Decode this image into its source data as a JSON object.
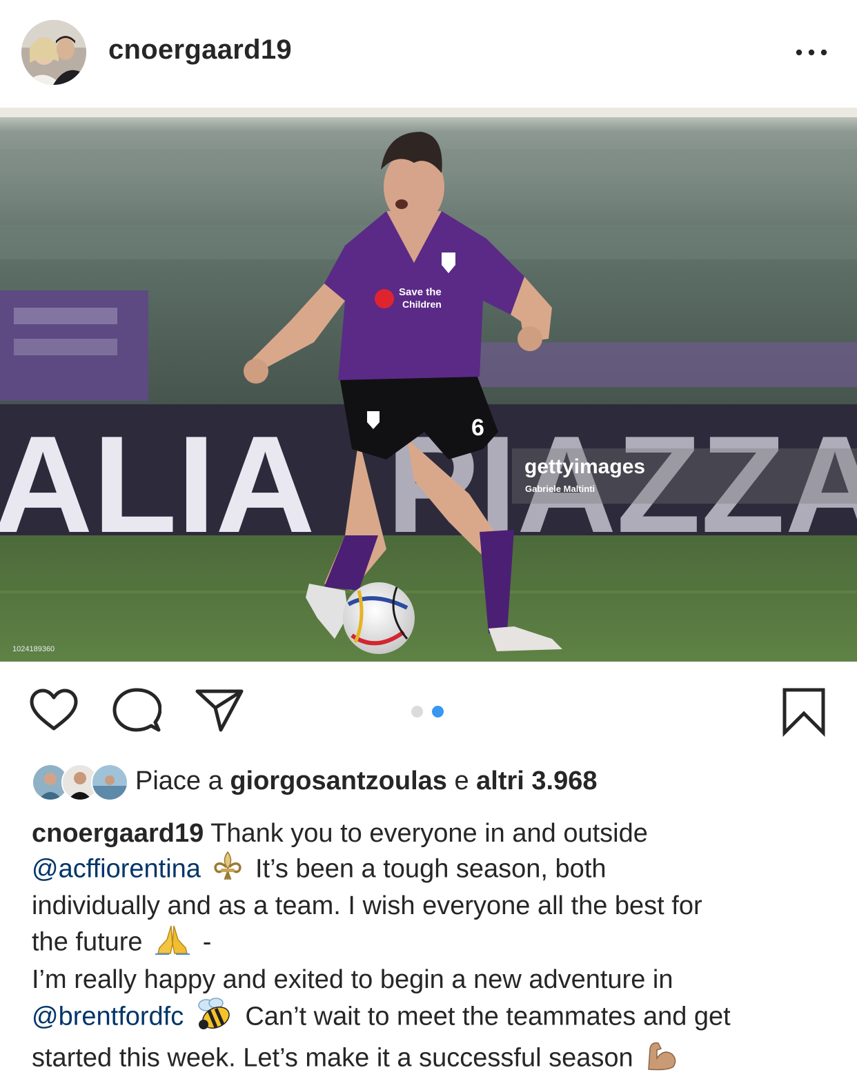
{
  "header": {
    "username": "cnoergaard19",
    "avatar_icon": "profile-avatar",
    "more_icon": "more-options-icon"
  },
  "photo": {
    "watermark_brand": "gettyimages",
    "watermark_credit": "Gabriele Maltinti",
    "image_id": "1024189360",
    "sponsor_text": "Save the Children",
    "board_left_text": "ALIA"
  },
  "actions": {
    "like_icon": "heart-icon",
    "comment_icon": "comment-icon",
    "share_icon": "send-icon",
    "save_icon": "bookmark-icon",
    "carousel_total": 2,
    "carousel_active": 2
  },
  "likes": {
    "prefix": "Piace a",
    "first_liker": "giorgosantzoulas",
    "conjunction": "e",
    "others": "altri 3.968"
  },
  "caption": {
    "username": "cnoergaard19",
    "l1_text": "Thank you to everyone in and outside",
    "l2_mention": "@acffiorentina",
    "l2_text": "It’s been a tough season, both",
    "l3_text": "individually and as a team. I wish everyone all the best for",
    "l4_text": "the future",
    "l4_dash": "-",
    "l5_text": "I’m really happy and exited to begin a new adventure in",
    "l6_mention": "@brentfordfc",
    "l6_text": "Can’t wait to meet the teammates and get",
    "l7_text": "started this week. Let’s make it a successful season",
    "emojis": [
      "fleur-de-lis",
      "folded-hands",
      "honeybee",
      "flexed-biceps"
    ]
  },
  "colors": {
    "text": "#262626",
    "mention": "#003569",
    "dot_active": "#3897f0",
    "dot_inactive": "#dbdbdb",
    "jersey_purple": "#5b2a86"
  }
}
